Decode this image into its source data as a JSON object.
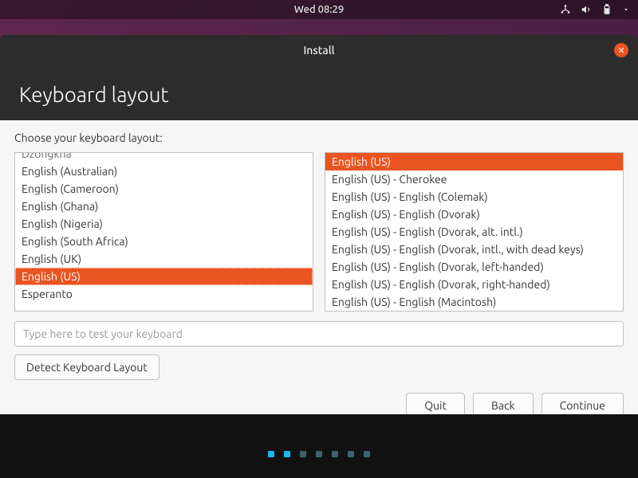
{
  "topbar": {
    "clock": "Wed 08:29"
  },
  "window": {
    "title": "Install",
    "page_title": "Keyboard layout"
  },
  "subhead": "Choose your keyboard layout:",
  "left_list": {
    "items": [
      "Dzongkha",
      "English (Australian)",
      "English (Cameroon)",
      "English (Ghana)",
      "English (Nigeria)",
      "English (South Africa)",
      "English (UK)",
      "English (US)",
      "Esperanto"
    ],
    "selected_index": 7
  },
  "right_list": {
    "items": [
      "English (US)",
      "English (US) - Cherokee",
      "English (US) - English (Colemak)",
      "English (US) - English (Dvorak)",
      "English (US) - English (Dvorak, alt. intl.)",
      "English (US) - English (Dvorak, intl., with dead keys)",
      "English (US) - English (Dvorak, left-handed)",
      "English (US) - English (Dvorak, right-handed)",
      "English (US) - English (Macintosh)"
    ],
    "selected_index": 0
  },
  "test_input": {
    "placeholder": "Type here to test your keyboard",
    "value": ""
  },
  "buttons": {
    "detect": "Detect Keyboard Layout",
    "quit": "Quit",
    "back": "Back",
    "continue": "Continue"
  },
  "progress_dots": {
    "total": 7,
    "active_count": 2
  },
  "colors": {
    "accent": "#e95420"
  }
}
